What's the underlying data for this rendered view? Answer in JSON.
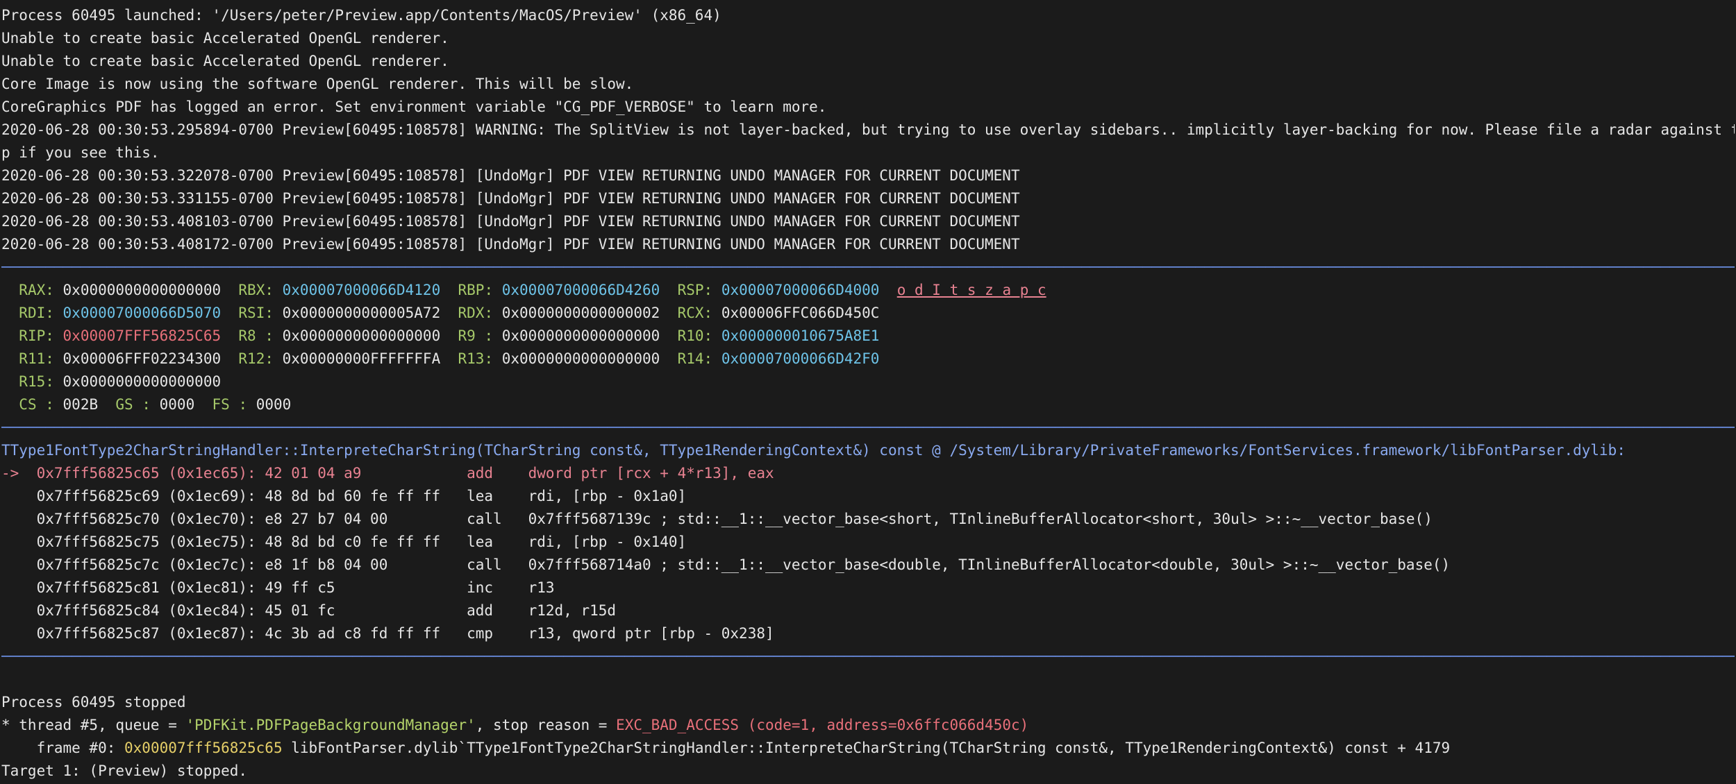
{
  "log": [
    "Process 60495 launched: '/Users/peter/Preview.app/Contents/MacOS/Preview' (x86_64)",
    "Unable to create basic Accelerated OpenGL renderer.",
    "Unable to create basic Accelerated OpenGL renderer.",
    "Core Image is now using the software OpenGL renderer. This will be slow.",
    "CoreGraphics PDF has logged an error. Set environment variable \"CG_PDF_VERBOSE\" to learn more.",
    "2020-06-28 00:30:53.295894-0700 Preview[60495:108578] WARNING: The SplitView is not layer-backed, but trying to use overlay sidebars.. implicitly layer-backing for now. Please file a radar against this ap",
    "p if you see this.",
    "2020-06-28 00:30:53.322078-0700 Preview[60495:108578] [UndoMgr] PDF VIEW RETURNING UNDO MANAGER FOR CURRENT DOCUMENT",
    "2020-06-28 00:30:53.331155-0700 Preview[60495:108578] [UndoMgr] PDF VIEW RETURNING UNDO MANAGER FOR CURRENT DOCUMENT",
    "2020-06-28 00:30:53.408103-0700 Preview[60495:108578] [UndoMgr] PDF VIEW RETURNING UNDO MANAGER FOR CURRENT DOCUMENT",
    "2020-06-28 00:30:53.408172-0700 Preview[60495:108578] [UndoMgr] PDF VIEW RETURNING UNDO MANAGER FOR CURRENT DOCUMENT"
  ],
  "separators": {
    "regs": "───────────────────────────────────────────────────────────────────────────────────────────────────────────────────────────────────────────────────────────────────────────────────────────────────────────────[regs]",
    "code": "───────────────────────────────────────────────────────────────────────────────────────────────────────────────────────────────────────────────────────────────────────────────────────────────────────────────[code]",
    "end": "────────────────────────────────────────────────────────────────────────────────────────────────────────────────────────────────────────────────────────────────────────────────────────────────────────────────────"
  },
  "regs": {
    "RAX": "0x0000000000000000",
    "RBX": "0x00007000066D4120",
    "RBP": "0x00007000066D4260",
    "RSP": "0x00007000066D4000",
    "flags": "o d I t s z a p c",
    "RDI": "0x00007000066D5070",
    "RSI": "0x0000000000005A72",
    "RDX": "0x0000000000000002",
    "RCX": "0x00006FFC066D450C",
    "RIP": "0x00007FFF56825C65",
    "R8": "0x0000000000000000",
    "R9": "0x0000000000000000",
    "R10": "0x000000010675A8E1",
    "R11": "0x00006FFF02234300",
    "R12": "0x00000000FFFFFFFA",
    "R13": "0x0000000000000000",
    "R14": "0x00007000066D42F0",
    "R15": "0x0000000000000000",
    "CS": "002B",
    "GS": "0000",
    "FS": "0000"
  },
  "code": {
    "function": "TType1FontType2CharStringHandler::InterpreteCharString(TCharString const&, TType1RenderingContext&) const @ /System/Library/PrivateFrameworks/FontServices.framework/libFontParser.dylib:",
    "arrow": "->",
    "lines": [
      {
        "addr": "0x7fff56825c65",
        "off": "(0x1ec65):",
        "bytes": "42 01 04 a9",
        "mn": "add",
        "ops": "dword ptr [rcx + 4*r13], eax"
      },
      {
        "addr": "0x7fff56825c69",
        "off": "(0x1ec69):",
        "bytes": "48 8d bd 60 fe ff ff",
        "mn": "lea",
        "ops": "rdi, [rbp - 0x1a0]"
      },
      {
        "addr": "0x7fff56825c70",
        "off": "(0x1ec70):",
        "bytes": "e8 27 b7 04 00",
        "mn": "call",
        "ops": "0x7fff5687139c ; std::__1::__vector_base<short, TInlineBufferAllocator<short, 30ul> >::~__vector_base()"
      },
      {
        "addr": "0x7fff56825c75",
        "off": "(0x1ec75):",
        "bytes": "48 8d bd c0 fe ff ff",
        "mn": "lea",
        "ops": "rdi, [rbp - 0x140]"
      },
      {
        "addr": "0x7fff56825c7c",
        "off": "(0x1ec7c):",
        "bytes": "e8 1f b8 04 00",
        "mn": "call",
        "ops": "0x7fff568714a0 ; std::__1::__vector_base<double, TInlineBufferAllocator<double, 30ul> >::~__vector_base()"
      },
      {
        "addr": "0x7fff56825c81",
        "off": "(0x1ec81):",
        "bytes": "49 ff c5",
        "mn": "inc",
        "ops": "r13"
      },
      {
        "addr": "0x7fff56825c84",
        "off": "(0x1ec84):",
        "bytes": "45 01 fc",
        "mn": "add",
        "ops": "r12d, r15d"
      },
      {
        "addr": "0x7fff56825c87",
        "off": "(0x1ec87):",
        "bytes": "4c 3b ad c8 fd ff ff",
        "mn": "cmp",
        "ops": "r13, qword ptr [rbp - 0x238]"
      }
    ]
  },
  "stop": {
    "line1": "Process 60495 stopped",
    "thread_prefix": "* thread #5, queue = ",
    "queue": "'PDFKit.PDFPageBackgroundManager'",
    "reason_prefix": ", stop reason = ",
    "reason": "EXC_BAD_ACCESS (code=1, address=0x6ffc066d450c)",
    "frame_prefix": "    frame #0: ",
    "frame_addr": "0x00007fff56825c65",
    "frame_rest": " libFontParser.dylib`TType1FontType2CharStringHandler::InterpreteCharString(TCharString const&, TType1RenderingContext&) const + 4179",
    "target": "Target 1: (Preview) stopped."
  }
}
